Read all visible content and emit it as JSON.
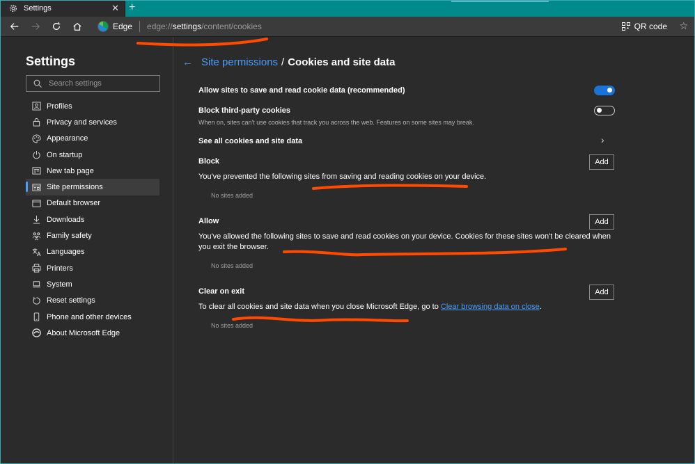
{
  "tab": {
    "title": "Settings",
    "close_icon": "close-icon",
    "new_tab_icon": "plus-icon"
  },
  "toolbar": {
    "browser_label": "Edge",
    "url_prefix": "edge://",
    "url_host": "settings",
    "url_path": "/content/cookies",
    "qr_label": "QR code"
  },
  "sidebar": {
    "title": "Settings",
    "search_placeholder": "Search settings",
    "items": [
      {
        "label": "Profiles",
        "icon": "profile-icon"
      },
      {
        "label": "Privacy and services",
        "icon": "lock-icon"
      },
      {
        "label": "Appearance",
        "icon": "palette-icon"
      },
      {
        "label": "On startup",
        "icon": "power-icon"
      },
      {
        "label": "New tab page",
        "icon": "newtab-icon"
      },
      {
        "label": "Site permissions",
        "icon": "site-permissions-icon",
        "active": true
      },
      {
        "label": "Default browser",
        "icon": "browser-icon"
      },
      {
        "label": "Downloads",
        "icon": "download-icon"
      },
      {
        "label": "Family safety",
        "icon": "family-icon"
      },
      {
        "label": "Languages",
        "icon": "language-icon"
      },
      {
        "label": "Printers",
        "icon": "printer-icon"
      },
      {
        "label": "System",
        "icon": "laptop-icon"
      },
      {
        "label": "Reset settings",
        "icon": "reset-icon"
      },
      {
        "label": "Phone and other devices",
        "icon": "phone-icon"
      },
      {
        "label": "About Microsoft Edge",
        "icon": "edge-icon"
      }
    ]
  },
  "main": {
    "breadcrumb_link": "Site permissions",
    "breadcrumb_sep": "/",
    "breadcrumb_current": "Cookies and site data",
    "allow_save_title": "Allow sites to save and read cookie data (recommended)",
    "allow_save_toggle": "on",
    "block_third_party_title": "Block third-party cookies",
    "block_third_party_desc": "When on, sites can't use cookies that track you across the web. Features on some sites may break.",
    "block_third_party_toggle": "off",
    "see_all_title": "See all cookies and site data",
    "add_label": "Add",
    "block": {
      "title": "Block",
      "desc": "You've prevented the following sites from saving and reading cookies on your device.",
      "empty": "No sites added"
    },
    "allow": {
      "title": "Allow",
      "desc": "You've allowed the following sites to save and read cookies on your device. Cookies for these sites won't be cleared when you exit the browser.",
      "empty": "No sites added"
    },
    "clear_on_exit": {
      "title": "Clear on exit",
      "desc": "To clear all cookies and site data when you close Microsoft Edge, go to",
      "link": "Clear browsing data on close",
      "desc_end": ".",
      "empty": "No sites added"
    }
  },
  "colors": {
    "accent": "#4a9df8",
    "toggle_on": "#1a73d6",
    "annotation": "#ff4a00",
    "titlebar": "#008a8a"
  }
}
